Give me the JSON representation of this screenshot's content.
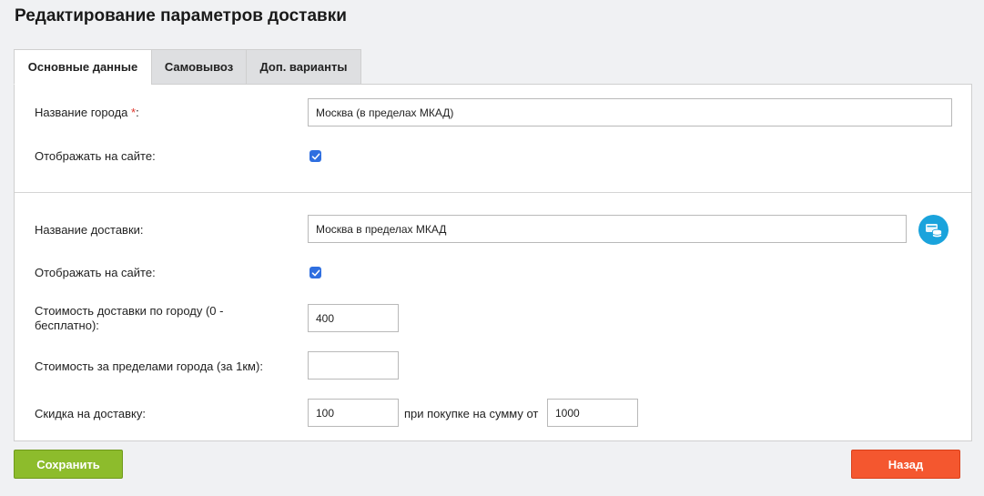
{
  "page": {
    "title": "Редактирование параметров доставки"
  },
  "tabs": [
    {
      "label": "Основные данные",
      "active": true
    },
    {
      "label": "Самовывоз",
      "active": false
    },
    {
      "label": "Доп. варианты",
      "active": false
    }
  ],
  "city": {
    "name_label": "Название города ",
    "required_mark": "*",
    "name_label_suffix": ":",
    "name_value": "Москва (в пределах МКАД)",
    "show_label": "Отображать на сайте:",
    "show_checked": true
  },
  "delivery": {
    "name_label": "Название доставки:",
    "name_value": "Москва в пределах МКАД",
    "db_icon": "database-icon",
    "show_label": "Отображать на сайте:",
    "show_checked": true,
    "city_cost_label": "Стоимость доставки по городу (0 - бесплатно):",
    "city_cost_value": "400",
    "outside_cost_label": "Стоимость за пределами города (за 1км):",
    "outside_cost_value": "",
    "discount_label": "Скидка на доставку:",
    "discount_value": "100",
    "min_sum_label": "при покупке на сумму от",
    "min_sum_value": "1000"
  },
  "actions": {
    "save_label": "Сохранить",
    "back_label": "Назад"
  },
  "colors": {
    "accent_checkbox": "#2f6fe0",
    "save_button": "#8dbc2c",
    "back_button": "#f4572f",
    "required": "#e0352b",
    "db_icon": "#1aa3dc"
  }
}
